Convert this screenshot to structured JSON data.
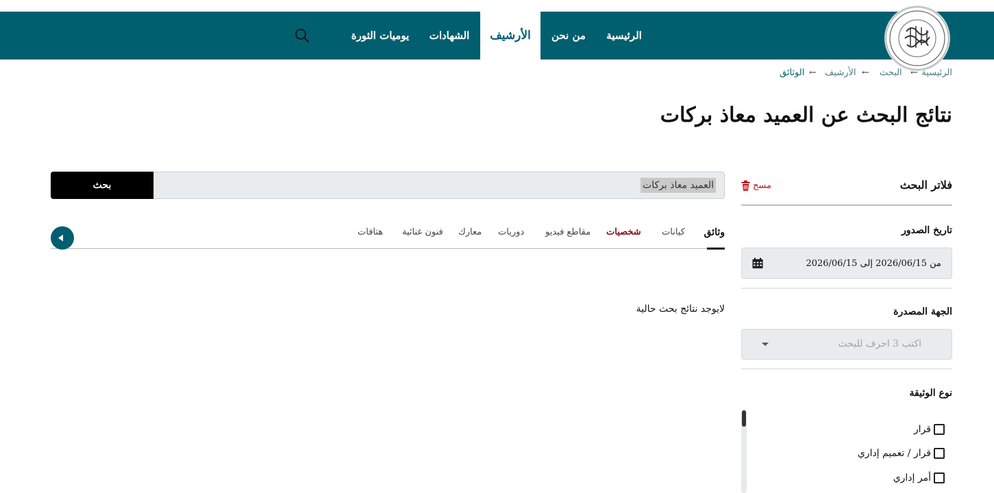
{
  "header": {
    "logo_text": "SYRIAN MEMORY INSTITUTION",
    "nav": {
      "home": "الرئيسية",
      "about": "من نحن",
      "archive": "الأرشيف",
      "testimonies": "الشهادات",
      "diary": "يوميات الثورة"
    },
    "brand_color": "#005f6f"
  },
  "breadcrumb": [
    "الرئيسية",
    "البحث",
    "الأرشيف",
    "الوثائق"
  ],
  "page_title": "نتائج البحث عن العميد معاذ بركات",
  "filters": {
    "title": "فلاتر البحث",
    "clear_label": "مسح",
    "date": {
      "label": "تاريخ الصدور",
      "value": "من 2026/06/15 إلى 2026/06/15"
    },
    "issuer": {
      "label": "الجهة المصدرة",
      "placeholder": "اكتب 3 احرف للبحث"
    },
    "doc_type": {
      "label": "نوع الوثيقة",
      "options": [
        "قرار",
        "قرار / تعميم إداري",
        "أمر إداري"
      ]
    }
  },
  "search": {
    "value": "العميد معاذ بركات",
    "button_label": "بحث"
  },
  "tabs": [
    "وثائق",
    "كيانات",
    "شخصيات",
    "مقاطع فيديو",
    "دوريات",
    "معارك",
    "فنون غنائية",
    "هتافات"
  ],
  "active_tab": "وثائق",
  "no_results": "لايوجد نتائج بحث حالية"
}
